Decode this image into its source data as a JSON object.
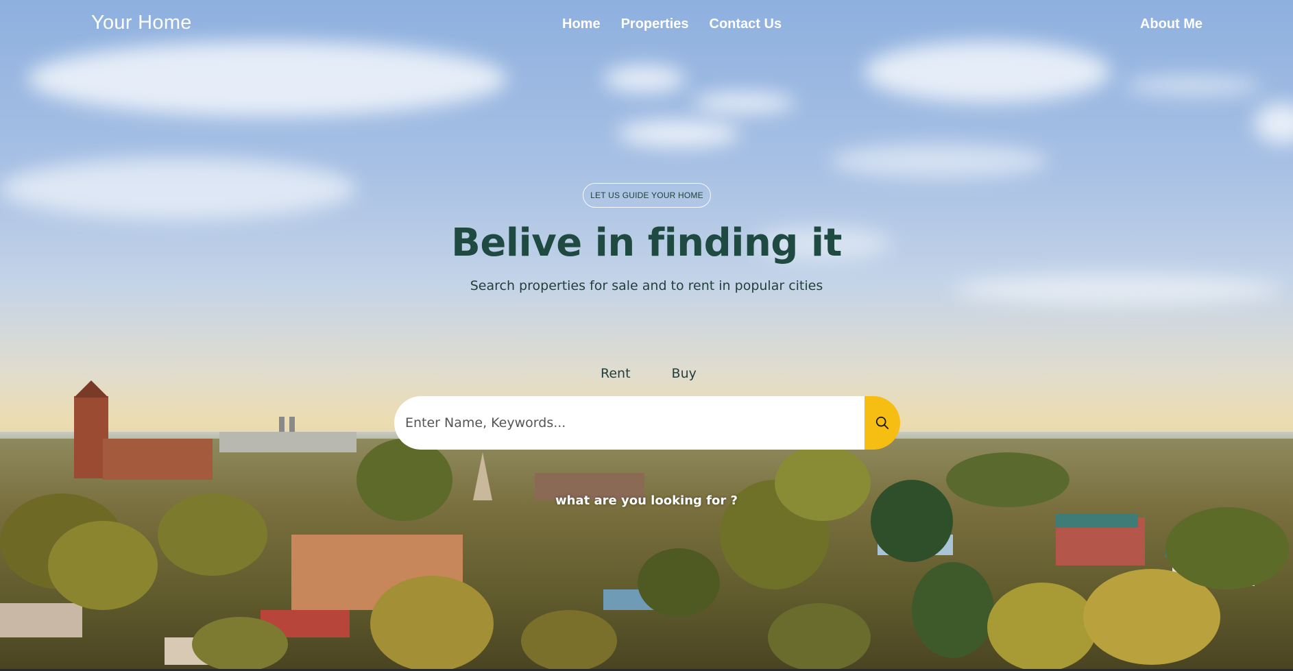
{
  "brand": {
    "name": "Your Home"
  },
  "nav": {
    "items": [
      {
        "label": "Home"
      },
      {
        "label": "Properties"
      },
      {
        "label": "Contact Us"
      }
    ],
    "about_label": "About Me"
  },
  "hero": {
    "eyebrow": "LET US GUIDE YOUR HOME",
    "headline": "Belive in finding it",
    "subheadline": "Search properties for sale and to rent in popular cities"
  },
  "search": {
    "tabs": [
      {
        "label": "Rent"
      },
      {
        "label": "Buy"
      }
    ],
    "placeholder": "Enter Name, Keywords...",
    "button_icon": "search-icon",
    "hint": "what are you looking for ?"
  },
  "colors": {
    "accent": "#f6be13",
    "headline": "#1f4a42",
    "text_dark": "#1f3f3a"
  }
}
